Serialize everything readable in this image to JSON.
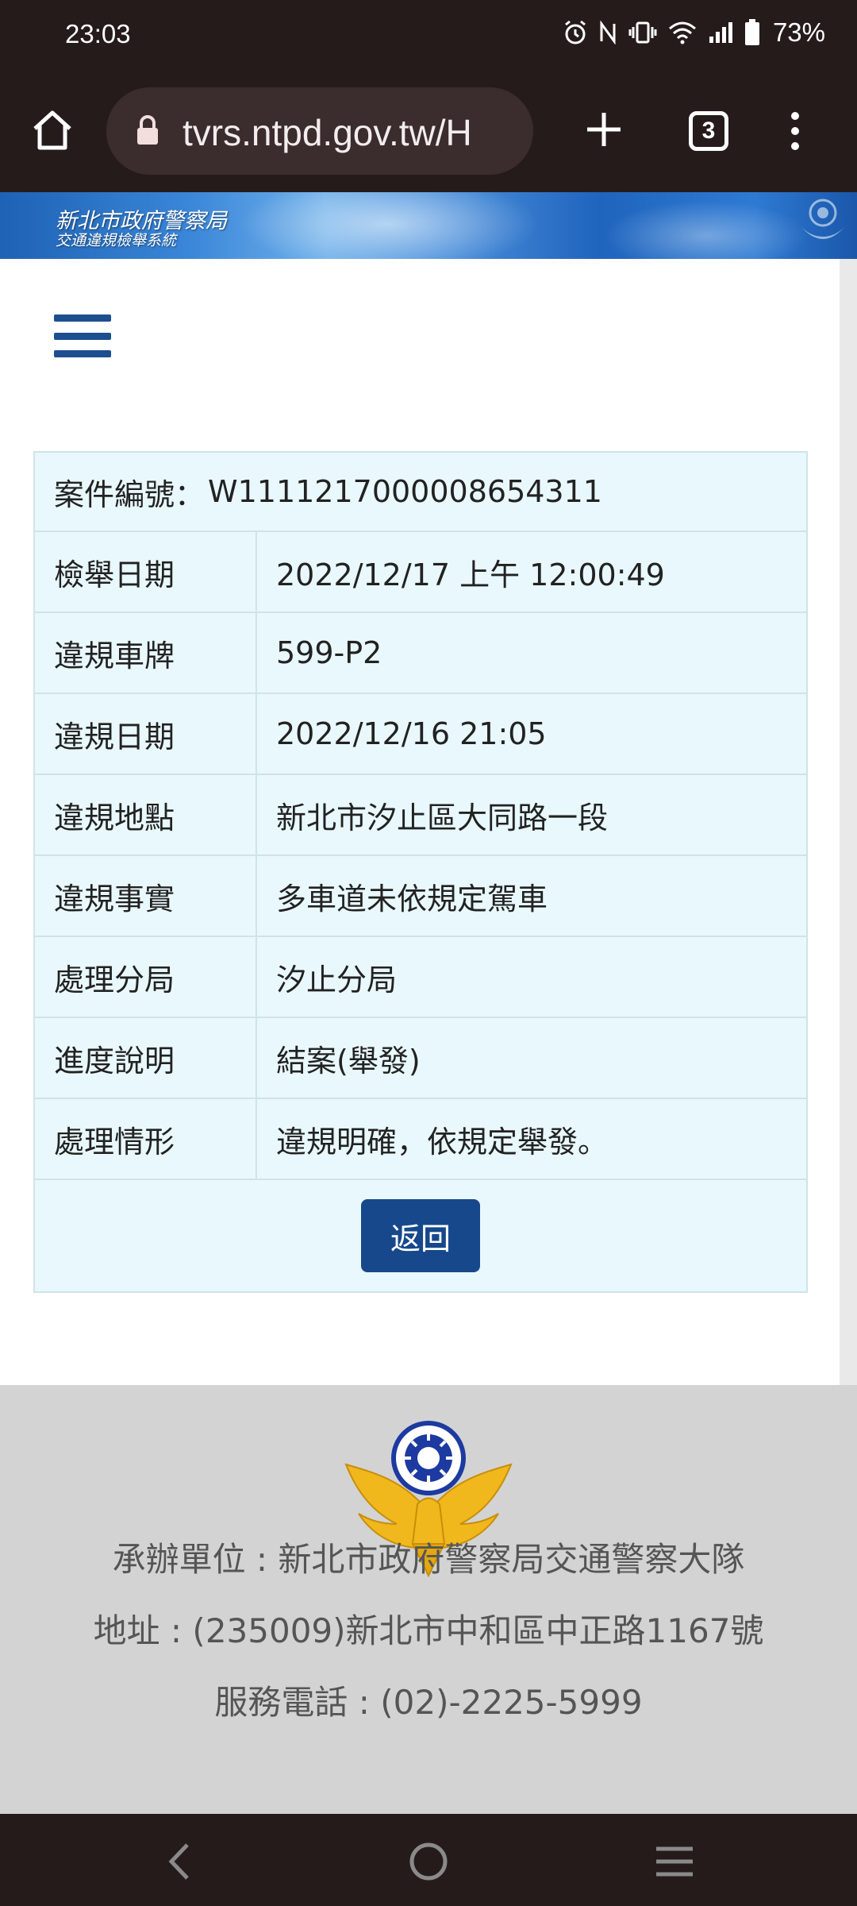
{
  "status_bar": {
    "time": "23:03",
    "battery_percent": "73%",
    "icons": [
      "alarm-icon",
      "nfc-icon",
      "vibrate-icon",
      "wifi-icon",
      "signal-icon",
      "battery-icon"
    ]
  },
  "browser": {
    "url": "tvrs.ntpd.gov.tw/H",
    "tab_count": "3"
  },
  "banner": {
    "title": "新北市政府警察局",
    "subtitle": "交通違規檢舉系統"
  },
  "case": {
    "number_label": "案件編號：",
    "number_value": "W1111217000008654311",
    "rows": [
      {
        "label": "檢舉日期",
        "value": "2022/12/17 上午 12:00:49"
      },
      {
        "label": "違規車牌",
        "value": "599-P2"
      },
      {
        "label": "違規日期",
        "value": "2022/12/16 21:05"
      },
      {
        "label": "違規地點",
        "value": "新北市汐止區大同路一段"
      },
      {
        "label": "違規事實",
        "value": "多車道未依規定駕車"
      },
      {
        "label": "處理分局",
        "value": "汐止分局"
      },
      {
        "label": "進度說明",
        "value": "結案(舉發)"
      },
      {
        "label": "處理情形",
        "value": "違規明確，依規定舉發。"
      }
    ],
    "back_label": "返回"
  },
  "footer": {
    "organizer": "承辦單位 : 新北市政府警察局交通警察大隊",
    "address": "地址 : (235009)新北市中和區中正路1167號",
    "phone": "服務電話 : (02)-2225-5999"
  },
  "colors": {
    "accent": "#17488c",
    "table_bg": "#e9f8fc",
    "table_border": "#cfe3ea",
    "footer_bg": "#d3d3d3",
    "system_bar": "#261b1b"
  }
}
